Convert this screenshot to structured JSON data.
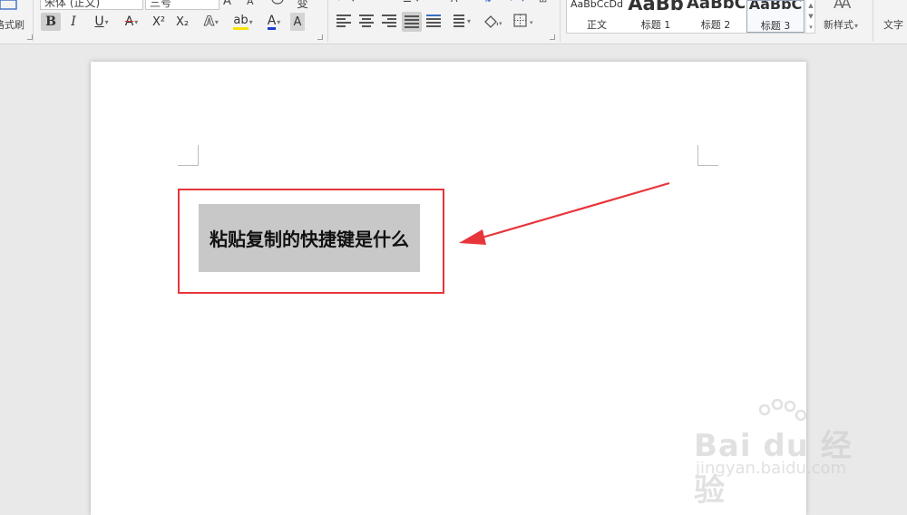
{
  "ribbon": {
    "format_painter_label": "格式刷",
    "font_name": "宋体 (正文)",
    "font_size": "三号",
    "buttons": {
      "bold": "B",
      "italic": "I",
      "underline": "U",
      "strikethrough": "A",
      "superscript": "X²",
      "subscript": "X₂",
      "text_effect": "A",
      "highlight": "ab",
      "font_color": "A",
      "char_shading": "A"
    },
    "styles": [
      {
        "preview": "AaBbCcDd",
        "name": "正文"
      },
      {
        "preview": "AaBb",
        "name": "标题 1"
      },
      {
        "preview": "AaBbC",
        "name": "标题 2"
      },
      {
        "preview": "AaBbC",
        "name": "标题 3"
      }
    ],
    "new_style_label": "新样式",
    "text_tools_label": "文字"
  },
  "document": {
    "selected_text": "粘贴复制的快捷键是什么"
  },
  "watermark": {
    "brand": "Bai du 经验",
    "url": "jingyan.baidu.com"
  },
  "colors": {
    "annotation_red": "#e8353b",
    "selection_gray": "#c8c8c8",
    "highlight_yellow": "#f5e400",
    "font_color_blue": "#1d3fd1"
  }
}
